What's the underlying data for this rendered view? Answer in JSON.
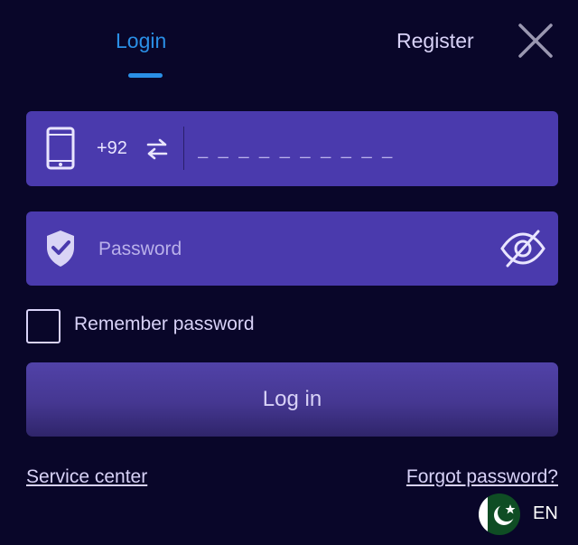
{
  "tabs": {
    "login_label": "Login",
    "register_label": "Register"
  },
  "phone": {
    "country_code": "+92",
    "placeholder": "_ _ _ _ _ _ _ _ _ _"
  },
  "password": {
    "placeholder": "Password"
  },
  "remember": {
    "label": "Remember password",
    "checked": false
  },
  "login_button_label": "Log in",
  "footer": {
    "service_center": "Service center",
    "forgot_password": "Forgot password?",
    "language": "EN"
  },
  "icons": {
    "close": "close-icon",
    "phone": "phone-icon",
    "swap": "swap-icon",
    "shield": "shield-check-icon",
    "eye": "eye-slash-icon",
    "flag": "pakistan-flag-icon"
  },
  "colors": {
    "background": "#090629",
    "field": "#4a3aad",
    "accent": "#2a8fe6",
    "text": "#d8d2f7"
  }
}
